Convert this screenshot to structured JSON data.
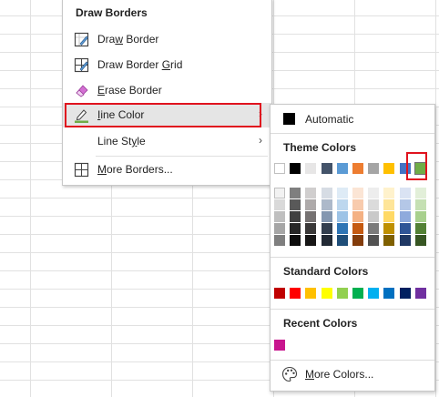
{
  "menu": {
    "header": "Draw Borders",
    "items": [
      {
        "label_pre": "Dra",
        "label_ul": "w",
        "label_post": " Border",
        "icon": "draw-border-icon"
      },
      {
        "label_pre": "Draw Border ",
        "label_ul": "G",
        "label_post": "rid",
        "icon": "draw-border-grid-icon"
      },
      {
        "label_pre": "",
        "label_ul": "E",
        "label_post": "rase Border",
        "icon": "eraser-icon"
      },
      {
        "label_pre": "",
        "label_ul": "I",
        "label_post": "ine Color",
        "icon": "pencil-line-color-icon"
      },
      {
        "label_pre": "Line St",
        "label_ul": "y",
        "label_post": "le",
        "icon": ""
      },
      {
        "label_pre": "",
        "label_ul": "M",
        "label_post": "ore Borders...",
        "icon": "grid-icon"
      }
    ],
    "submenu_arrow": "›"
  },
  "palette": {
    "automatic_label": "Automatic",
    "theme_title": "Theme Colors",
    "theme_base": [
      "#ffffff",
      "#000000",
      "#e7e6e6",
      "#44546a",
      "#5b9bd5",
      "#ed7d31",
      "#a5a5a5",
      "#ffc000",
      "#4472c4",
      "#70ad47"
    ],
    "theme_shades": [
      [
        "#f2f2f2",
        "#d9d9d9",
        "#bfbfbf",
        "#a6a6a6",
        "#7f7f7f"
      ],
      [
        "#7f7f7f",
        "#595959",
        "#404040",
        "#262626",
        "#0d0d0d"
      ],
      [
        "#d0cece",
        "#aeaaaa",
        "#757171",
        "#3a3838",
        "#171616"
      ],
      [
        "#d6dce4",
        "#adb9ca",
        "#8497b0",
        "#333f4f",
        "#222a35"
      ],
      [
        "#deebf6",
        "#bdd7ee",
        "#9dc3e6",
        "#2e75b5",
        "#1f4e79"
      ],
      [
        "#fbe5d5",
        "#f8cbad",
        "#f4b183",
        "#c55a11",
        "#833c0b"
      ],
      [
        "#ededed",
        "#dbdbdb",
        "#c9c9c9",
        "#7b7b7b",
        "#525252"
      ],
      [
        "#fff2cc",
        "#fee599",
        "#ffd965",
        "#bf9000",
        "#7f6000"
      ],
      [
        "#dae3f3",
        "#b4c7e7",
        "#8faadc",
        "#2f5597",
        "#1f3864"
      ],
      [
        "#e2efd9",
        "#c5e0b3",
        "#a8d08d",
        "#538135",
        "#375623"
      ]
    ],
    "standard_title": "Standard Colors",
    "standard": [
      "#c00000",
      "#ff0000",
      "#ffc000",
      "#ffff00",
      "#92d050",
      "#00b050",
      "#00b0f0",
      "#0070c0",
      "#002060",
      "#7030a0"
    ],
    "recent_title": "Recent Colors",
    "recent": [
      "#c8168e"
    ],
    "more_colors_pre": "",
    "more_colors_ul": "M",
    "more_colors_post": "ore Colors..."
  }
}
